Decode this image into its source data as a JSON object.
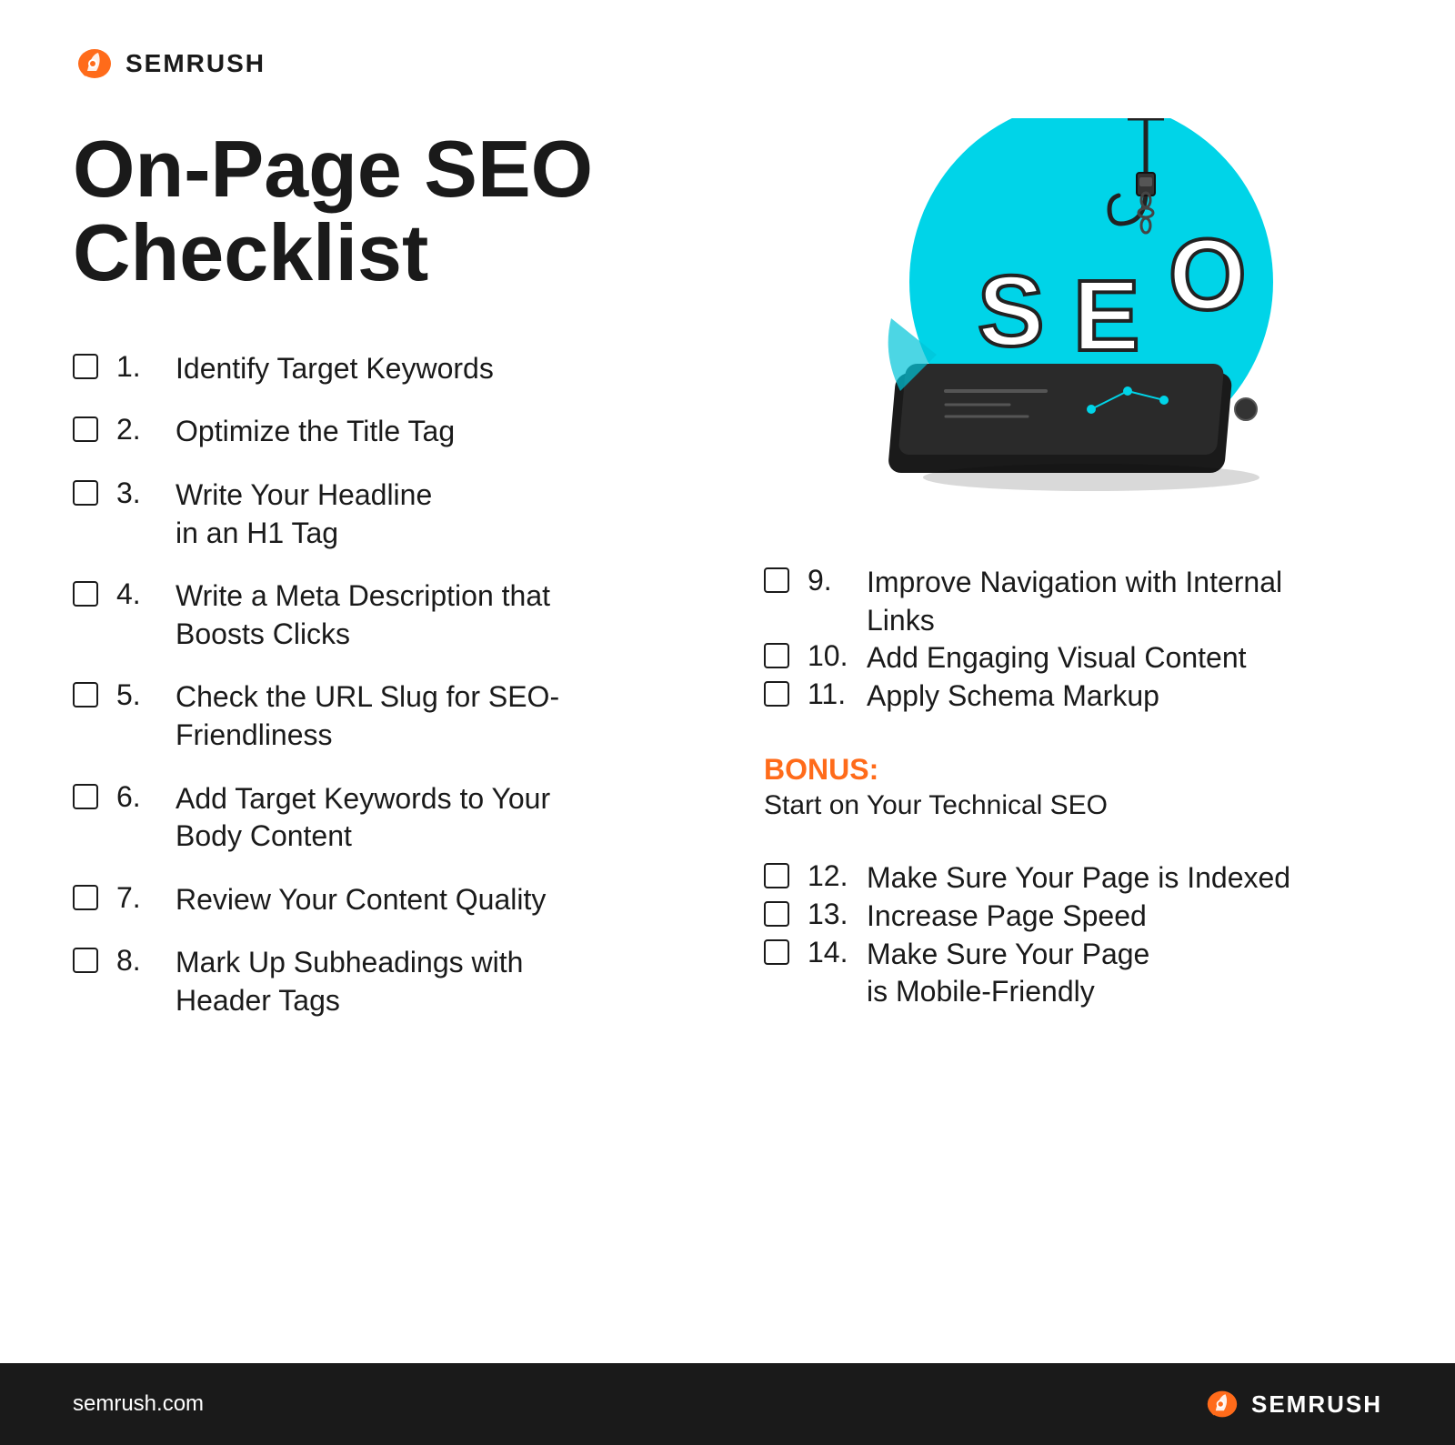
{
  "logo": {
    "text": "SEMRUSH",
    "url": "semrush.com"
  },
  "title": {
    "line1": "On-Page SEO",
    "line2": "Checklist"
  },
  "left_items": [
    {
      "number": "1.",
      "text": "Identify Target Keywords"
    },
    {
      "number": "2.",
      "text": "Optimize the Title Tag"
    },
    {
      "number": "3.",
      "text": "Write Your Headline\nin an H1 Tag"
    },
    {
      "number": "4.",
      "text": "Write a Meta Description that\nBoosts Clicks"
    },
    {
      "number": "5.",
      "text": "Check the URL Slug for SEO-\nFriendliness"
    },
    {
      "number": "6.",
      "text": "Add Target Keywords to Your\nBody Content"
    },
    {
      "number": "7.",
      "text": "Review Your Content Quality"
    },
    {
      "number": "8.",
      "text": "Mark Up Subheadings with\nHeader Tags"
    }
  ],
  "right_items": [
    {
      "number": "9.",
      "text": "Improve Navigation with Internal\nLinks"
    },
    {
      "number": "10.",
      "text": "Add Engaging Visual Content"
    },
    {
      "number": "11.",
      "text": "Apply Schema Markup"
    },
    {
      "number": "12.",
      "text": "Make Sure Your Page is Indexed"
    },
    {
      "number": "13.",
      "text": "Increase Page Speed"
    },
    {
      "number": "14.",
      "text": "Make Sure Your Page\nis Mobile-Friendly"
    }
  ],
  "bonus": {
    "label": "BONUS:",
    "subtitle": "Start on Your Technical SEO"
  },
  "colors": {
    "orange": "#ff6b1a",
    "dark": "#1a1a1a",
    "cyan": "#00d4e8",
    "white": "#ffffff"
  }
}
